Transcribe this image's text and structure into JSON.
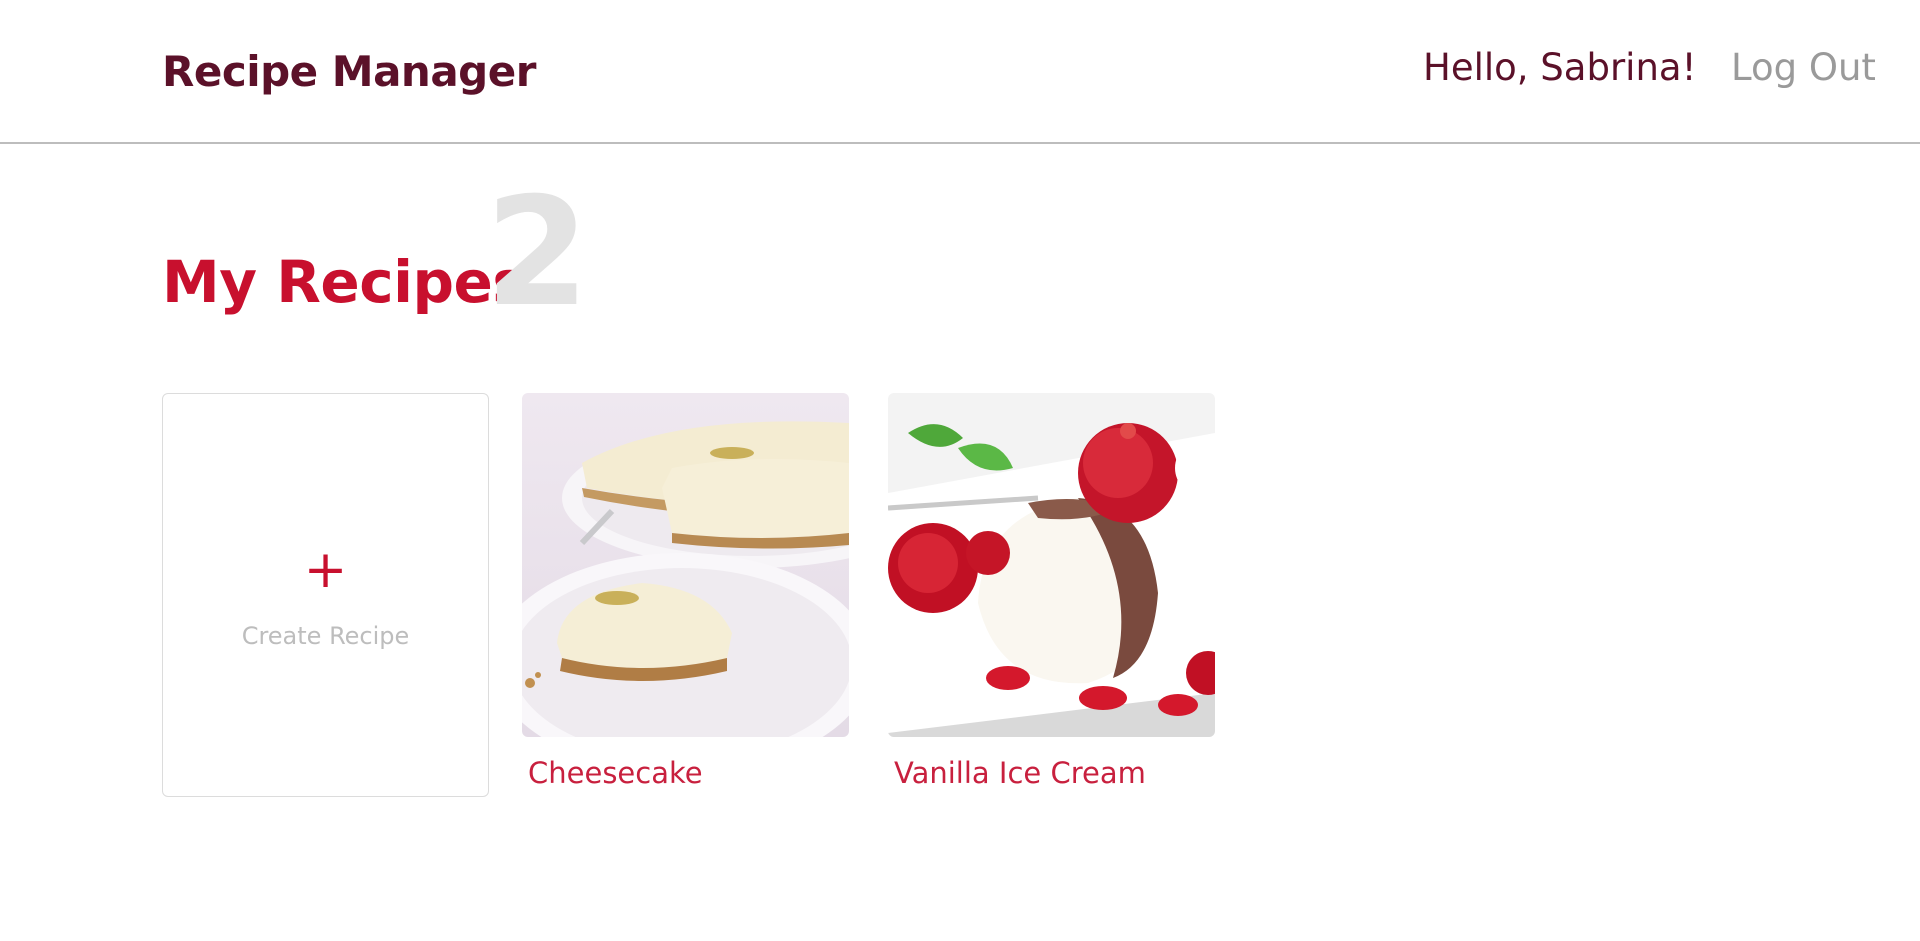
{
  "header": {
    "app_title": "Recipe Manager",
    "greeting": "Hello, Sabrina!",
    "logout_label": "Log Out"
  },
  "main": {
    "heading": "My Recipes",
    "recipe_count": "2",
    "create_card": {
      "icon": "plus-icon",
      "plus_glyph": "+",
      "label": "Create Recipe"
    },
    "recipes": [
      {
        "title": "Cheesecake",
        "image": "cheesecake-photo"
      },
      {
        "title": "Vanilla Ice Cream",
        "image": "vanilla-ice-cream-photo"
      }
    ]
  },
  "colors": {
    "brand_dark": "#5b1129",
    "accent": "#c8102e",
    "muted": "#9a9a9a",
    "count": "#e3e3e3"
  }
}
